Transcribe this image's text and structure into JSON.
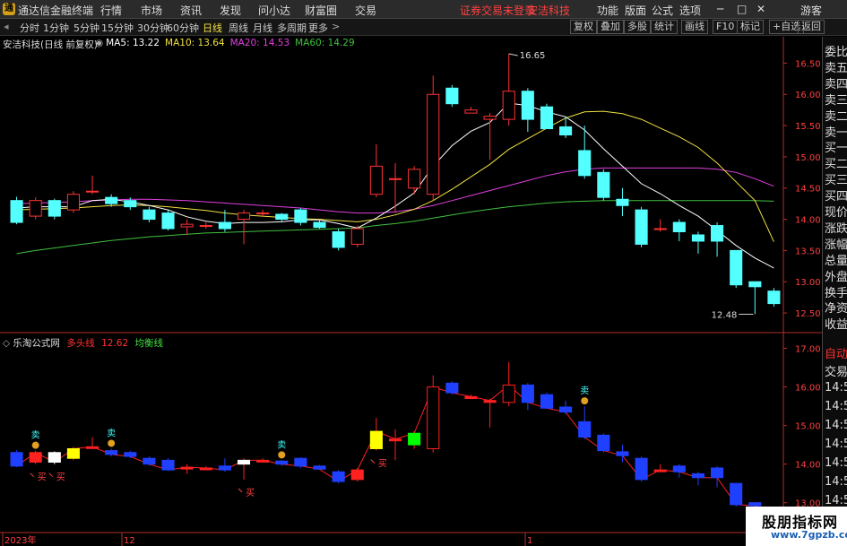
{
  "menubar": {
    "app_title": "通达信金融终端",
    "items": [
      "行情",
      "市场",
      "资讯",
      "发现",
      "问小达",
      "财富圈",
      "交易"
    ],
    "notice": "证券交易未登录",
    "stock": "安洁科技",
    "right": [
      "功能",
      "版面",
      "公式",
      "选项"
    ],
    "win": [
      "─",
      "□",
      "✕"
    ],
    "guest": "游客"
  },
  "toolbar": {
    "periods": [
      "分时",
      "1分钟",
      "5分钟",
      "15分钟",
      "30分钟",
      "60分钟",
      "日线",
      "周线",
      "月线",
      "多周期",
      "更多"
    ],
    "active": "日线",
    "buttons": [
      "复权",
      "叠加",
      "多股",
      "统计",
      "画线",
      "F10",
      "标记",
      "+自选",
      "返回"
    ]
  },
  "main_header": {
    "name": "安洁科技(日线 前复权)",
    "ma": [
      {
        "label": "MA5: 13.22",
        "color": "#ffffff"
      },
      {
        "label": "MA10: 13.64",
        "color": "#f0e040"
      },
      {
        "label": "MA20: 14.53",
        "color": "#e040e0"
      },
      {
        "label": "MA60: 14.29",
        "color": "#40c040"
      }
    ]
  },
  "main_axis": {
    "ticks": [
      "16.50",
      "16.00",
      "15.50",
      "15.00",
      "14.50",
      "14.00",
      "13.50",
      "13.00",
      "12.50"
    ],
    "max_label": "16.65",
    "min_label": "12.48"
  },
  "sub_header": {
    "name": "乐淘公式网",
    "line1": "多头线",
    "line1_value": "12.62",
    "line2": "均衡线"
  },
  "sub_axis": {
    "ticks": [
      "17.00",
      "16.00",
      "15.00",
      "14.00",
      "13.00"
    ]
  },
  "date_axis": {
    "labels": [
      "2023年",
      "12",
      "1"
    ]
  },
  "signals": {
    "sell": "卖",
    "buy": "买"
  },
  "side_panel": [
    "委比",
    "卖五",
    "卖四",
    "卖三",
    "卖二",
    "卖一",
    "买一",
    "买二",
    "买三",
    "买四",
    "现价",
    "涨跌",
    "涨幅",
    "总量",
    "外盘",
    "换手",
    "净资",
    "收益",
    "自动",
    "交易",
    "14:5",
    "14:5",
    "14:5",
    "14:5",
    "14:5",
    "14:5",
    "14:5",
    "14:5",
    "14:5"
  ],
  "colors": {
    "up": "#ff3232",
    "down": "#54ffff",
    "ma5": "#ffffff",
    "ma10": "#f0e040",
    "ma20": "#e040e0",
    "ma60": "#40c040",
    "sub_up": "#ff2020",
    "sub_down": "#2040ff"
  },
  "chart_data": {
    "type": "candlestick",
    "ylim": [
      12.3,
      16.75
    ],
    "sub_ylim": [
      12.9,
      17.2
    ],
    "candles": [
      [
        14.3,
        13.95,
        14.36,
        13.92
      ],
      [
        14.05,
        14.3,
        14.35,
        14.0
      ],
      [
        14.3,
        14.05,
        14.33,
        14.0
      ],
      [
        14.15,
        14.4,
        14.45,
        14.1
      ],
      [
        14.45,
        14.45,
        14.7,
        14.4
      ],
      [
        14.35,
        14.25,
        14.4,
        14.2
      ],
      [
        14.3,
        14.2,
        14.35,
        14.15
      ],
      [
        14.15,
        14.0,
        14.2,
        13.95
      ],
      [
        14.1,
        13.85,
        14.15,
        13.82
      ],
      [
        13.88,
        13.92,
        14.0,
        13.75
      ],
      [
        13.9,
        13.9,
        13.95,
        13.85
      ],
      [
        13.95,
        13.85,
        14.15,
        13.8
      ],
      [
        14.0,
        14.1,
        14.15,
        13.6
      ],
      [
        14.1,
        14.1,
        14.15,
        14.05
      ],
      [
        14.08,
        14.0,
        14.1,
        13.95
      ],
      [
        14.15,
        13.95,
        14.18,
        13.9
      ],
      [
        13.95,
        13.87,
        13.98,
        13.85
      ],
      [
        13.8,
        13.55,
        13.85,
        13.5
      ],
      [
        13.6,
        13.85,
        13.9,
        13.55
      ],
      [
        14.4,
        14.85,
        15.2,
        14.35
      ],
      [
        14.65,
        14.65,
        14.9,
        14.1
      ],
      [
        14.5,
        14.8,
        14.85,
        14.4
      ],
      [
        14.4,
        16.0,
        16.3,
        14.3
      ],
      [
        16.1,
        15.85,
        16.15,
        15.8
      ],
      [
        15.7,
        15.75,
        15.8,
        15.7
      ],
      [
        15.6,
        15.65,
        15.7,
        14.95
      ],
      [
        15.6,
        16.05,
        16.65,
        15.5
      ],
      [
        16.05,
        15.6,
        16.1,
        15.4
      ],
      [
        15.8,
        15.45,
        15.85,
        15.45
      ],
      [
        15.48,
        15.35,
        15.65,
        15.3
      ],
      [
        15.1,
        14.7,
        15.5,
        14.65
      ],
      [
        14.75,
        14.35,
        14.8,
        14.3
      ],
      [
        14.32,
        14.22,
        14.5,
        14.05
      ],
      [
        14.15,
        13.6,
        14.2,
        13.55
      ],
      [
        13.85,
        13.85,
        14.0,
        13.8
      ],
      [
        13.95,
        13.8,
        14.0,
        13.65
      ],
      [
        13.75,
        13.65,
        13.8,
        13.45
      ],
      [
        13.9,
        13.65,
        13.95,
        13.4
      ],
      [
        13.5,
        12.95,
        13.5,
        12.9
      ],
      [
        13.0,
        12.92,
        13.0,
        12.48
      ],
      [
        12.85,
        12.65,
        12.9,
        12.6
      ]
    ],
    "ma5": [
      14.18,
      14.2,
      14.2,
      14.2,
      14.3,
      14.32,
      14.28,
      14.22,
      14.15,
      14.04,
      13.97,
      13.93,
      13.95,
      13.95,
      13.96,
      13.99,
      13.99,
      13.93,
      13.86,
      14.02,
      14.21,
      14.42,
      14.85,
      15.18,
      15.41,
      15.55,
      15.86,
      15.82,
      15.72,
      15.64,
      15.43,
      15.13,
      14.85,
      14.57,
      14.41,
      14.22,
      14.05,
      13.82,
      13.58,
      13.38,
      13.22
    ],
    "ma10": [
      14.15,
      14.16,
      14.17,
      14.18,
      14.2,
      14.22,
      14.23,
      14.22,
      14.2,
      14.17,
      14.14,
      14.1,
      14.07,
      14.05,
      14.03,
      14.01,
      14.0,
      13.98,
      13.96,
      14.0,
      14.07,
      14.16,
      14.3,
      14.48,
      14.68,
      14.88,
      15.12,
      15.29,
      15.46,
      15.62,
      15.72,
      15.73,
      15.69,
      15.6,
      15.46,
      15.32,
      15.15,
      14.9,
      14.6,
      14.3,
      13.64
    ],
    "ma20": [
      14.25,
      14.26,
      14.27,
      14.28,
      14.3,
      14.31,
      14.32,
      14.32,
      14.31,
      14.3,
      14.28,
      14.26,
      14.24,
      14.22,
      14.2,
      14.18,
      14.15,
      14.12,
      14.1,
      14.1,
      14.12,
      14.16,
      14.22,
      14.3,
      14.38,
      14.46,
      14.54,
      14.62,
      14.7,
      14.76,
      14.8,
      14.82,
      14.82,
      14.82,
      14.82,
      14.82,
      14.82,
      14.8,
      14.75,
      14.65,
      14.53
    ],
    "ma60": [
      13.45,
      13.5,
      13.54,
      13.58,
      13.62,
      13.66,
      13.69,
      13.72,
      13.74,
      13.76,
      13.78,
      13.79,
      13.8,
      13.81,
      13.82,
      13.83,
      13.84,
      13.85,
      13.86,
      13.9,
      13.93,
      13.97,
      14.02,
      14.07,
      14.12,
      14.16,
      14.2,
      14.23,
      14.26,
      14.28,
      14.29,
      14.3,
      14.3,
      14.3,
      14.3,
      14.3,
      14.3,
      14.3,
      14.3,
      14.3,
      14.29
    ],
    "sub_signals": [
      {
        "i": 1,
        "type": "sell"
      },
      {
        "i": 1,
        "type": "buy"
      },
      {
        "i": 2,
        "type": "buy"
      },
      {
        "i": 5,
        "type": "sell"
      },
      {
        "i": 12,
        "type": "buy"
      },
      {
        "i": 14,
        "type": "sell"
      },
      {
        "i": 19,
        "type": "buy"
      },
      {
        "i": 30,
        "type": "sell"
      }
    ],
    "highlight": {
      "3": "#ffff00",
      "12": "#ffffff",
      "19": "#ffff00",
      "21": "#00ff00",
      "2": "#ffffff"
    }
  }
}
